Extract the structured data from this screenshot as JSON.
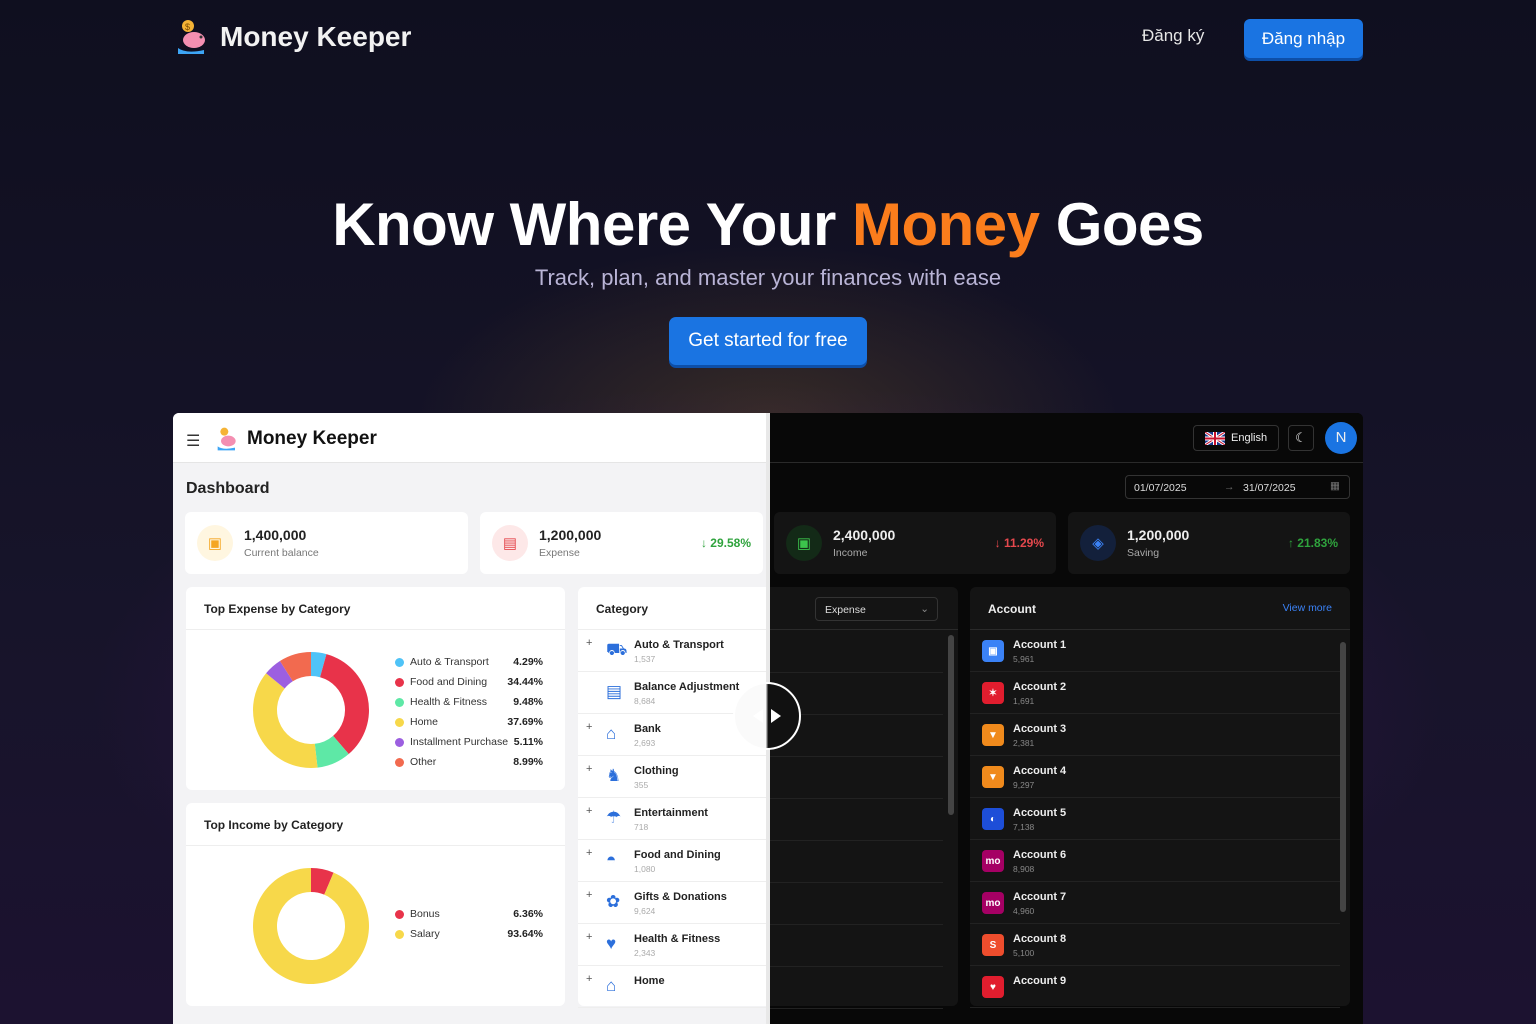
{
  "nav": {
    "brand": "Money Keeper",
    "register_label": "Đăng ký",
    "login_label": "Đăng nhập"
  },
  "hero": {
    "title_before": "Know Where Your ",
    "title_accent": "Money",
    "title_after": " Goes",
    "subtitle": "Track, plan, and master your finances with ease",
    "cta_label": "Get started for free"
  },
  "app": {
    "brand": "Money Keeper",
    "page_title": "Dashboard",
    "language": "English",
    "avatar_initial": "N",
    "date_from": "01/07/2025",
    "date_to": "31/07/2025",
    "stats": [
      {
        "value": "1,400,000",
        "label": "Current balance",
        "pct": ""
      },
      {
        "value": "1,200,000",
        "label": "Expense",
        "pct": "29.58%",
        "dir": "down",
        "color": "#2fa33d"
      },
      {
        "value": "2,400,000",
        "label": "Income",
        "pct": "11.29%",
        "dir": "down",
        "color": "#e5484d"
      },
      {
        "value": "1,200,000",
        "label": "Saving",
        "pct": "21.83%",
        "dir": "up",
        "color": "#2fa33d"
      }
    ],
    "top_expense": {
      "title": "Top Expense by Category",
      "items": [
        {
          "name": "Auto & Transport",
          "pct": "4.29%",
          "value": 4.29,
          "color": "#4fc3f7"
        },
        {
          "name": "Food and Dining",
          "pct": "34.44%",
          "value": 34.44,
          "color": "#e8334a"
        },
        {
          "name": "Health & Fitness",
          "pct": "9.48%",
          "value": 9.48,
          "color": "#5ee8a6"
        },
        {
          "name": "Home",
          "pct": "37.69%",
          "value": 37.69,
          "color": "#f7d84a"
        },
        {
          "name": "Installment Purchase",
          "pct": "5.11%",
          "value": 5.11,
          "color": "#9c5fe0"
        },
        {
          "name": "Other",
          "pct": "8.99%",
          "value": 8.99,
          "color": "#f26a4f"
        }
      ]
    },
    "top_income": {
      "title": "Top Income by Category",
      "items": [
        {
          "name": "Bonus",
          "pct": "6.36%",
          "value": 6.36,
          "color": "#e8334a"
        },
        {
          "name": "Salary",
          "pct": "93.64%",
          "value": 93.64,
          "color": "#f7d84a"
        }
      ]
    },
    "category": {
      "title": "Category",
      "filter": "Expense",
      "items": [
        {
          "name": "Auto & Transport",
          "count": "1,537",
          "icon": "car-icon",
          "glyph": "⛟",
          "expand": true
        },
        {
          "name": "Balance Adjustment",
          "count": "8,684",
          "icon": "archive-icon",
          "glyph": "▤",
          "expand": false
        },
        {
          "name": "Bank",
          "count": "2,693",
          "icon": "bank-icon",
          "glyph": "⌂",
          "expand": true
        },
        {
          "name": "Clothing",
          "count": "355",
          "icon": "shirt-icon",
          "glyph": "♞",
          "expand": true
        },
        {
          "name": "Entertainment",
          "count": "718",
          "icon": "umbrella-icon",
          "glyph": "☂",
          "expand": true
        },
        {
          "name": "Food and Dining",
          "count": "1,080",
          "icon": "food-icon",
          "glyph": "◓",
          "expand": true
        },
        {
          "name": "Gifts & Donations",
          "count": "9,624",
          "icon": "gift-icon",
          "glyph": "✿",
          "expand": true
        },
        {
          "name": "Health & Fitness",
          "count": "2,343",
          "icon": "heart-icon",
          "glyph": "♥",
          "expand": true
        },
        {
          "name": "Home",
          "count": "",
          "icon": "home-icon",
          "glyph": "⌂",
          "expand": true
        }
      ]
    },
    "account": {
      "title": "Account",
      "view_more": "View more",
      "items": [
        {
          "name": "Account 1",
          "balance": "5,961",
          "icon": "wallet-icon",
          "glyph": "▣",
          "color": "#3b82f6"
        },
        {
          "name": "Account 2",
          "balance": "1,691",
          "icon": "star-icon",
          "glyph": "✶",
          "color": "#e11d2e"
        },
        {
          "name": "Account 3",
          "balance": "2,381",
          "icon": "triangle-logo-icon",
          "glyph": "▼",
          "color": "#f08a1c"
        },
        {
          "name": "Account 4",
          "balance": "9,297",
          "icon": "triangle-logo-icon",
          "glyph": "▼",
          "color": "#f08a1c"
        },
        {
          "name": "Account 5",
          "balance": "7,138",
          "icon": "circle-logo-icon",
          "glyph": "◐",
          "color": "#1d4ed8"
        },
        {
          "name": "Account 6",
          "balance": "8,908",
          "icon": "momo-icon",
          "glyph": "mo",
          "color": "#a50064"
        },
        {
          "name": "Account 7",
          "balance": "4,960",
          "icon": "momo-icon",
          "glyph": "mo",
          "color": "#a50064"
        },
        {
          "name": "Account 8",
          "balance": "5,100",
          "icon": "shopee-icon",
          "glyph": "S",
          "color": "#ee4d2d"
        },
        {
          "name": "Account 9",
          "balance": "",
          "icon": "pay-icon",
          "glyph": "♥",
          "color": "#e11d2e"
        }
      ]
    }
  }
}
